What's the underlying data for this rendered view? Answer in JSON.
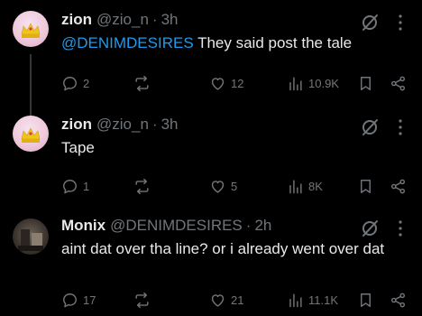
{
  "posts": [
    {
      "name": "zion",
      "handle": "@zio_n",
      "dot": "·",
      "time": "3h",
      "mention": "@DENIMDESIRES",
      "text": " They said post the tale",
      "replies": "2",
      "reposts": "",
      "likes": "12",
      "views": "10.9K"
    },
    {
      "name": "zion",
      "handle": "@zio_n",
      "dot": "·",
      "time": "3h",
      "mention": "",
      "text": "Tape",
      "replies": "1",
      "reposts": "",
      "likes": "5",
      "views": "8K"
    },
    {
      "name": "Monix",
      "handle": "@DENIMDESIRES",
      "dot": "·",
      "time": "2h",
      "mention": "",
      "text": "aint dat over tha line? or i already went over dat",
      "replies": "17",
      "reposts": "",
      "likes": "21",
      "views": "11.1K"
    }
  ],
  "icons": {
    "grok": "grok-icon",
    "more": "more-icon",
    "reply": "reply-icon",
    "repost": "repost-icon",
    "like": "heart-icon",
    "views": "views-icon",
    "bookmark": "bookmark-icon",
    "share": "share-icon"
  },
  "colors": {
    "accent": "#1d9bf0",
    "muted": "#71767b",
    "text": "#e7e9ea",
    "background": "#000000"
  }
}
